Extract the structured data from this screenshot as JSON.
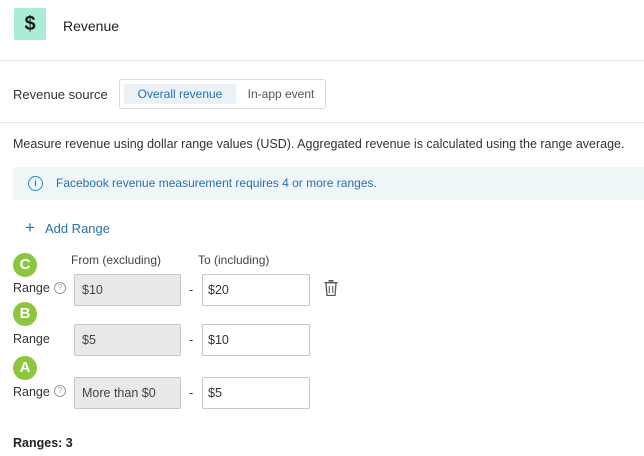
{
  "header": {
    "icon": "$",
    "title": "Revenue"
  },
  "revenue_source": {
    "label": "Revenue source",
    "options": [
      "Overall revenue",
      "In-app event"
    ],
    "selected": "Overall revenue"
  },
  "description": "Measure revenue using dollar range values (USD). Aggregated revenue is calculated using the range average.",
  "info": {
    "icon": "info-icon",
    "text": "Facebook revenue measurement requires 4 or more ranges."
  },
  "add_range": {
    "plus": "+",
    "label": "Add Range"
  },
  "columns": {
    "from": "From (excluding)",
    "to": "To (including)"
  },
  "ranges": [
    {
      "badge": "C",
      "label": "Range",
      "from": "$10",
      "to": "$20"
    },
    {
      "badge": "B",
      "label": "Range",
      "from": "$5",
      "to": "$10"
    },
    {
      "badge": "A",
      "label": "Range",
      "from": "More than $0",
      "to": "$5"
    }
  ],
  "help_glyph": "?",
  "dash": "-",
  "summary": "Ranges: 3",
  "colors": {
    "badge": "#8cc63f",
    "accent": "#2a6fb0",
    "icon_bg": "#a9ecd8"
  }
}
